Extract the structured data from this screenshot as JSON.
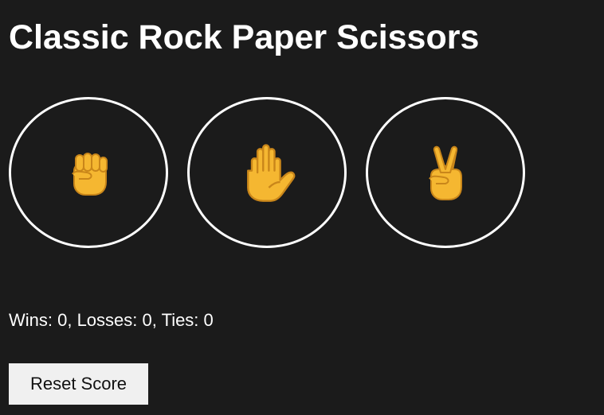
{
  "game": {
    "title": "Classic Rock Paper Scissors"
  },
  "choices": [
    {
      "name": "rock",
      "icon": "raised-fist-icon",
      "color": "#F5B731"
    },
    {
      "name": "paper",
      "icon": "raised-hand-icon",
      "color": "#F5B731"
    },
    {
      "name": "scissors",
      "icon": "victory-hand-icon",
      "color": "#F5B731"
    }
  ],
  "score": {
    "text": "Wins: 0, Losses: 0, Ties: 0"
  },
  "controls": {
    "reset_label": "Reset Score"
  },
  "colors": {
    "background": "#1b1b1b",
    "emoji": "#F5B731",
    "ring": "#ffffff",
    "button_bg": "#f0f0f0"
  }
}
